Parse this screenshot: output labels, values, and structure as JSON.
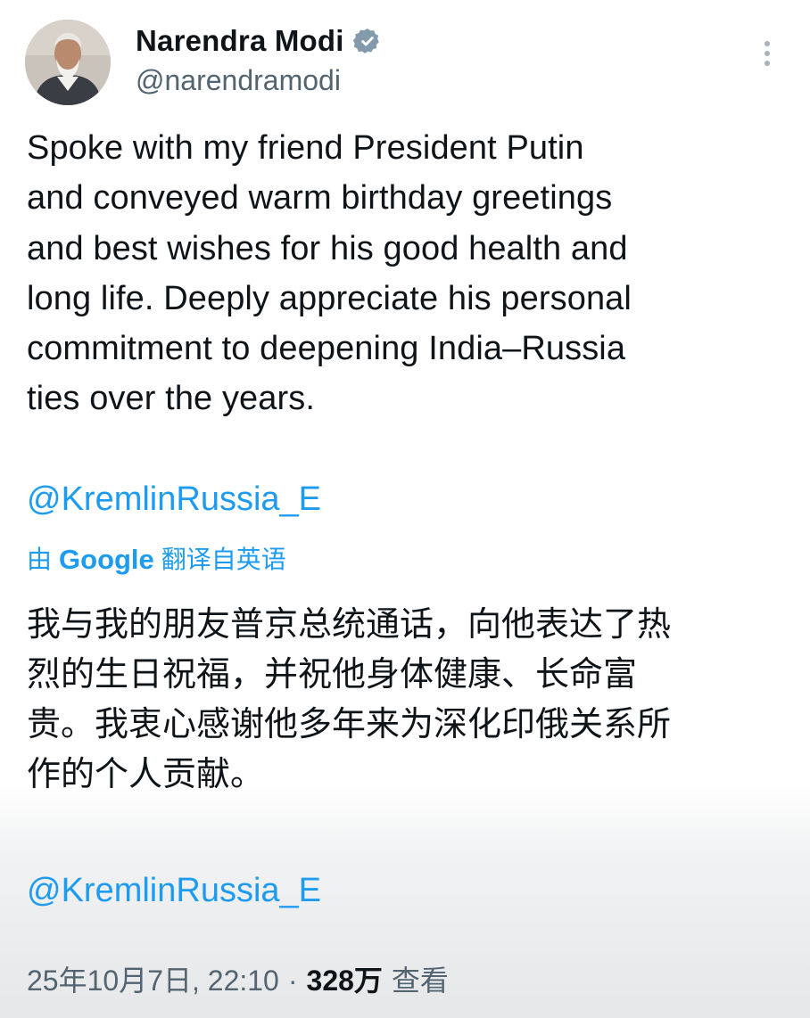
{
  "author": {
    "display_name": "Narendra Modi",
    "handle": "@narendramodi",
    "verified": true,
    "verified_color": "#1d9bf0"
  },
  "icons": {
    "verified": "verified-badge-icon",
    "more": "more-vertical-icon",
    "avatar": "profile-photo"
  },
  "post": {
    "text": "Spoke with my friend President Putin\nand conveyed warm birthday greetings\nand best wishes for his good health and\nlong life. Deeply appreciate his personal\ncommitment to deepening India–Russia\nties over the years.",
    "mention": "@KremlinRussia_E"
  },
  "translation": {
    "prefix": "由",
    "provider": "Google",
    "suffix": "翻译自英语",
    "text": "我与我的朋友普京总统通话，向他表达了热\n烈的生日祝福，并祝他身体健康、长命富\n贵。我衷心感谢他多年来为深化印俄关系所\n作的个人贡献。",
    "mention": "@KremlinRussia_E"
  },
  "meta": {
    "timestamp": "25年10月7日, 22:10",
    "separator": "·",
    "views_count": "328万",
    "views_label": "查看"
  },
  "colors": {
    "link": "#1d9bf0",
    "text": "#0f1419",
    "secondary": "#536471"
  }
}
